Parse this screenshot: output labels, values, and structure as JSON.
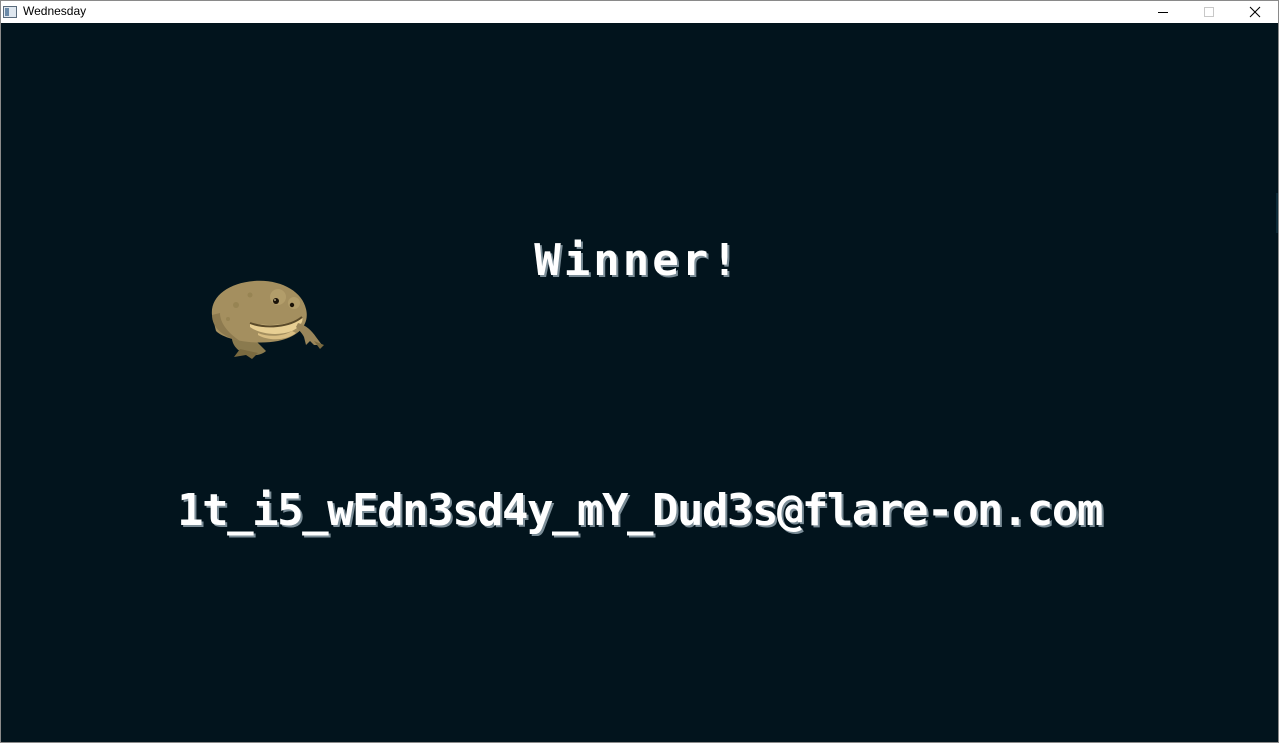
{
  "window": {
    "title": "Wednesday",
    "controls": {
      "minimize": "minimize-icon",
      "maximize": "maximize-icon",
      "close": "close-icon"
    }
  },
  "game": {
    "background_color": "#02141d",
    "text_color": "#ffffff",
    "winner_text": "Winner!",
    "flag_text": "1t_i5_wEdn3sd4y_mY_Dud3s@flare-on.com",
    "sprite": "frog-sprite"
  }
}
